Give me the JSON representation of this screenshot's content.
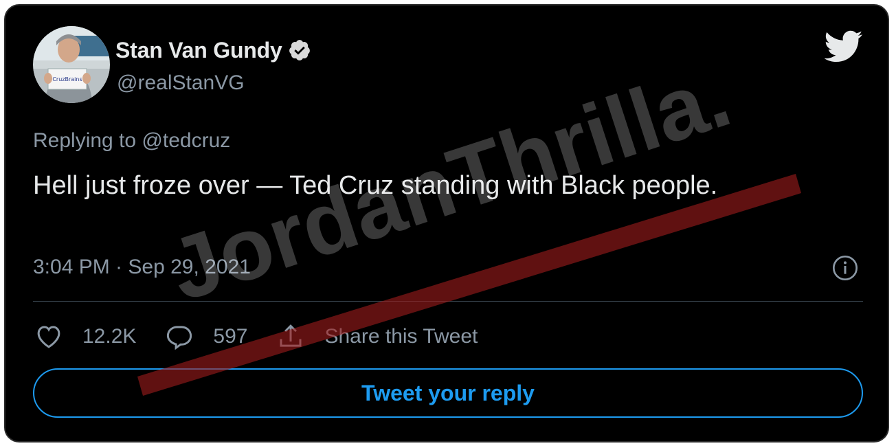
{
  "author": {
    "display_name": "Stan Van Gundy",
    "handle": "@realStanVG",
    "verified": true,
    "avatar_sign_text": "CruzBrains"
  },
  "tweet": {
    "replying_to": "Replying to @tedcruz",
    "text": "Hell just froze over — Ted Cruz standing with Black people.",
    "timestamp": "3:04 PM · Sep 29, 2021"
  },
  "actions": {
    "likes": "12.2K",
    "replies": "597",
    "share_label": "Share this Tweet"
  },
  "reply_button_label": "Tweet your reply",
  "watermark": {
    "text": "JordanThrilla."
  },
  "icons": {
    "brand": "twitter-bird-icon",
    "verified": "verified-badge-icon",
    "info": "info-icon",
    "like": "heart-icon",
    "reply": "comment-icon",
    "share": "share-icon"
  },
  "colors": {
    "background": "#000000",
    "primary_text": "#e7e9ea",
    "secondary_text": "#8b98a5",
    "accent": "#1d9bf0",
    "divider": "#38444d",
    "watermark_stripe": "#a01c1c"
  }
}
